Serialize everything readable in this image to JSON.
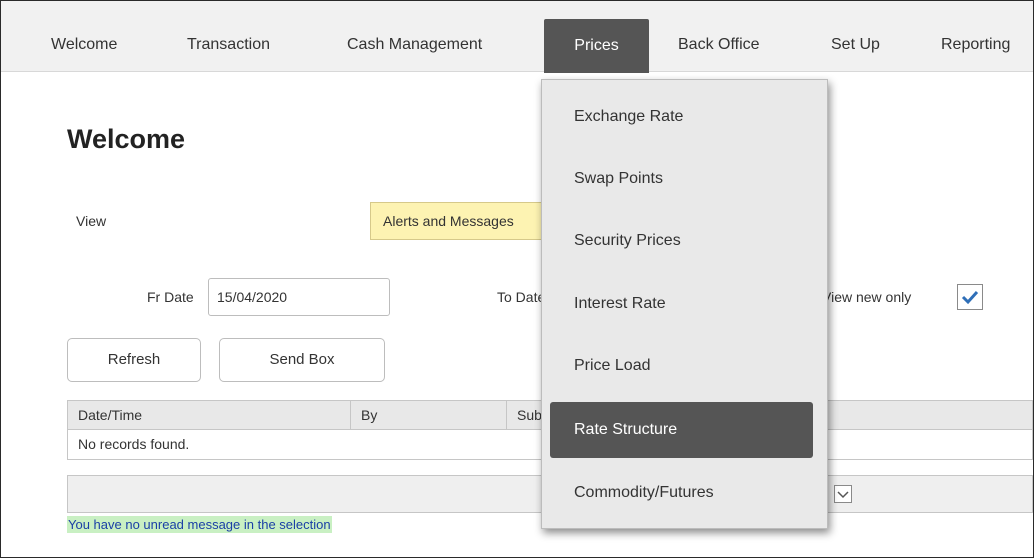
{
  "menu": {
    "items": [
      {
        "label": "Welcome"
      },
      {
        "label": "Transaction"
      },
      {
        "label": "Cash Management"
      },
      {
        "label": "Prices"
      },
      {
        "label": "Back Office"
      },
      {
        "label": "Set Up"
      },
      {
        "label": "Reporting"
      }
    ],
    "active": "Prices"
  },
  "prices_menu": {
    "items": [
      {
        "label": "Exchange Rate"
      },
      {
        "label": "Swap Points"
      },
      {
        "label": "Security Prices"
      },
      {
        "label": "Interest Rate"
      },
      {
        "label": "Price Load"
      },
      {
        "label": "Rate Structure"
      },
      {
        "label": "Commodity/Futures"
      }
    ],
    "highlighted": "Rate Structure"
  },
  "page": {
    "title": "Welcome",
    "view_label": "View",
    "view_value": "Alerts and Messages",
    "fr_date_label": "Fr Date",
    "fr_date_value": "15/04/2020",
    "to_date_label": "To Date",
    "view_new_only_label": "View new only",
    "view_new_only_checked": true
  },
  "buttons": {
    "refresh": "Refresh",
    "send_box": "Send Box"
  },
  "grid": {
    "columns": [
      "Date/Time",
      "By",
      "Subject"
    ],
    "empty_text": "No records found."
  },
  "status": {
    "message": "You have no unread message in the selection"
  },
  "icons": {
    "checkbox_check": "checkmark-icon",
    "pager_select": "chevron-down-icon"
  },
  "colors": {
    "menubar_bg": "#f1f1f1",
    "active_menu_bg": "#555555",
    "view_select_bg": "#fdf3b2",
    "status_bg": "#c9f0c3",
    "status_text": "#1a3fa6",
    "check_color": "#2f6fb8"
  }
}
